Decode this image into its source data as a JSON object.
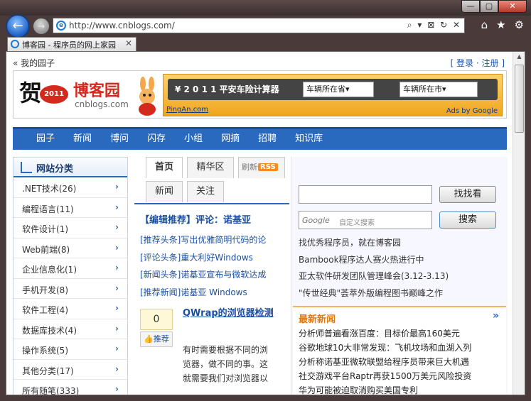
{
  "browser": {
    "address": "http://www.cnblogs.com/",
    "address_tools": "⌕ ▾ ⊠ ↻ ✕",
    "tab_title": "博客园 - 程序员的网上家园",
    "tab_close": "✕",
    "back_glyph": "←",
    "forward_glyph": "→",
    "chrome_icons": [
      "home-icon",
      "star-icon",
      "gear-icon"
    ],
    "window_buttons": [
      "—",
      "▢",
      "✕"
    ]
  },
  "header": {
    "my_garden": "« 我的园子",
    "login_links": "[ 登录 · 注册 ]"
  },
  "banner": {
    "logo_char": "贺",
    "logo_year": "2011",
    "logo_name": "博客园",
    "logo_domain": "cnblogs.com",
    "ad_title": "¥ 2 0 1 1 平安车险计算器",
    "ad_select_1": "车辆所在省▾",
    "ad_select_2": "车辆所在市▾",
    "ad_source": "PingAn.com",
    "ad_google": "Ads by Google"
  },
  "nav": [
    "园子",
    "新闻",
    "博问",
    "闪存",
    "小组",
    "网摘",
    "招聘",
    "知识库"
  ],
  "sidebar": {
    "title": "网站分类",
    "items": [
      ".NET技术(26)",
      "编程语言(11)",
      "软件设计(1)",
      "Web前端(8)",
      "企业信息化(1)",
      "手机开发(8)",
      "软件工程(4)",
      "数据库技术(4)",
      "操作系统(5)",
      "其他分类(17)",
      "所有随笔(333)"
    ],
    "chevron": "›"
  },
  "middle": {
    "tabs": [
      "首页",
      "精华区",
      "刷新候选",
      "新闻",
      "关注"
    ],
    "rss": "RSS",
    "editor_pick": "【编辑推荐】评论：诺基亚",
    "pick_items": [
      "[推荐头条]写出优雅简明代码的论",
      "[评论头条]重大利好Windows",
      "[新闻头条]诺基亚宣布与微软达成",
      "[推荐新闻]诺基亚 Windows"
    ],
    "vote_count": "0",
    "vote_label": "推荐",
    "post_title": "QWrap的浏览器检测",
    "post_body": "有时需要根据不同的浏览器，做不同的事。这就需要我们对浏览器以"
  },
  "right": {
    "search_button": "找找看",
    "google_logo": "Google",
    "google_placeholder": "自定义搜索",
    "google_button": "搜索",
    "promos": [
      "找优秀程序员，就在博客园",
      "Bambook程序达人赛火热进行中",
      "亚太软件研发团队管理峰会(3.12-3.13)",
      "\"传世经典\"荟萃外版编程图书巅峰之作"
    ],
    "news_title": "最新新闻",
    "news_more": "»",
    "news": [
      "分析师普遍看涨百度：目标价最高160美元",
      "谷歌地球10大非常发现：飞机坟场和血湖入列",
      "分析称诺基亚微软联盟给程序员带来巨大机遇",
      "社交游戏平台Raptr再获1500万美元风险投资",
      "华为可能被迫取消购买美国专利"
    ]
  }
}
